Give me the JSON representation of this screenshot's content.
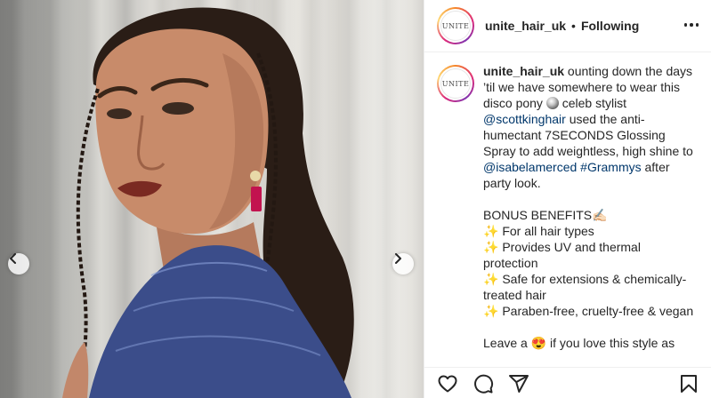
{
  "post": {
    "username": "unite_hair_uk",
    "separator": "•",
    "follow_status": "Following",
    "avatar_text": "UNITE"
  },
  "caption": {
    "username": "unite_hair_uk",
    "text_1": "ounting down the days ’til we have somewhere to wear this disco pony",
    "text_2": " celeb stylist ",
    "mention_1": "@scottkinghair",
    "text_3": " used the anti-humectant 7SECONDS Glossing Spray to add weightless, high shine to ",
    "mention_2": "@isabelamerced",
    "hashtag": "#Grammys",
    "text_4": " after party look.",
    "bonus_heading": "BONUS BENEFITS✍🏻",
    "benefits": [
      "✨ For all hair types",
      "✨ Provides UV and thermal protection",
      "✨ Safe for extensions & chemically-treated hair",
      "✨ Paraben-free, cruelty-free & vegan"
    ],
    "closing": "Leave a 😍 if you love this style as"
  },
  "icons": {
    "more": "more-options-icon",
    "like": "heart-icon",
    "comment": "comment-icon",
    "share": "share-icon",
    "save": "bookmark-icon",
    "prev": "chevron-left-icon",
    "next": "chevron-right-icon",
    "disco": "disco-ball-icon"
  }
}
